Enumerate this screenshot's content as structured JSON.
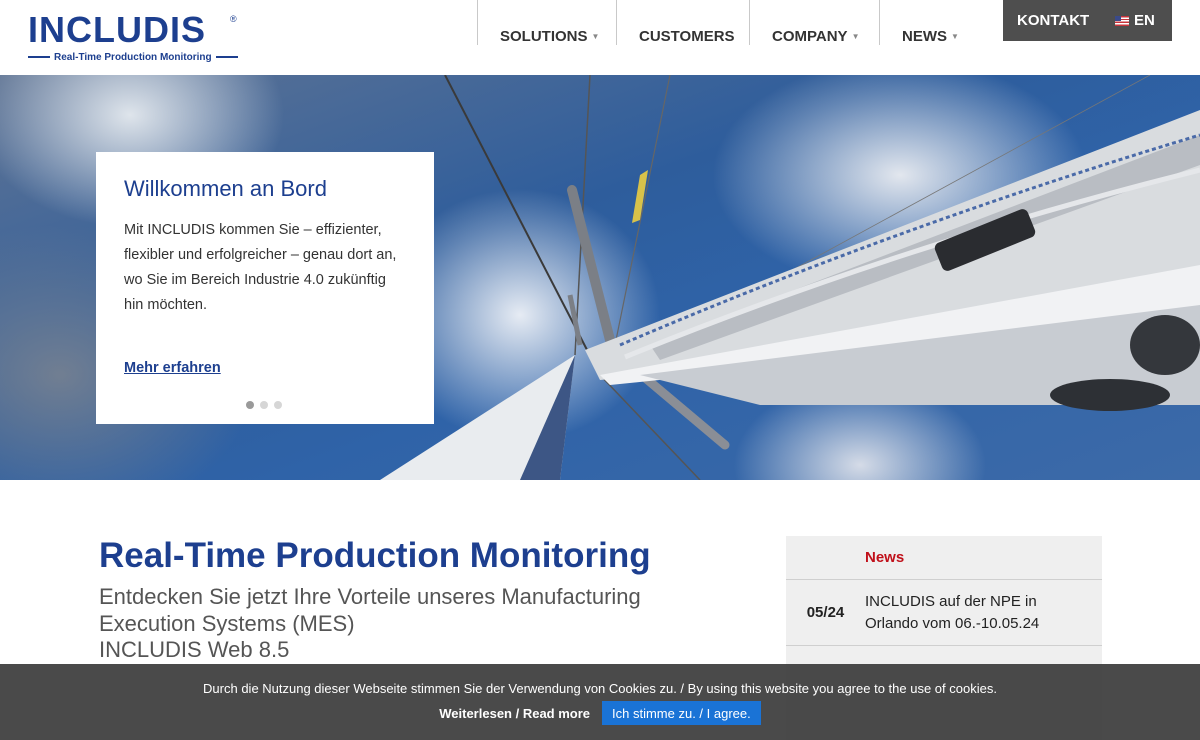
{
  "logo": {
    "name": "INCLUDIS",
    "registered": "®",
    "tagline": "Real-Time Production Monitoring"
  },
  "nav": {
    "items": [
      {
        "label": "SOLUTIONS",
        "has_dropdown": true
      },
      {
        "label": "CUSTOMERS",
        "has_dropdown": false
      },
      {
        "label": "COMPANY",
        "has_dropdown": true
      },
      {
        "label": "NEWS",
        "has_dropdown": true
      }
    ],
    "caret": "▼"
  },
  "topbar": {
    "contact_label": "KONTAKT",
    "language_label": "EN",
    "flag_icon": "us-flag-icon"
  },
  "hero": {
    "title": "Willkommen an Bord",
    "text": "Mit INCLUDIS kommen Sie – effizienter, flexibler und erfolgreicher – genau dort an, wo Sie im Bereich Industrie 4.0 zukünftig hin möchten.",
    "link": "Mehr erfahren",
    "slides": 3,
    "active_slide": 1
  },
  "main": {
    "title": "Real-Time Production Monitoring",
    "subtitle_line1": "Entdecken Sie jetzt Ihre Vorteile unseres Manufacturing Execution Systems (MES)",
    "subtitle_line2": "INCLUDIS Web 8.5"
  },
  "news": {
    "heading": "News",
    "heading_color": "#c0101a",
    "items": [
      {
        "date": "05/24",
        "text": "INCLUDIS auf der NPE in Orlando vom 06.-10.05.24"
      }
    ]
  },
  "cookie": {
    "message": "Durch die Nutzung dieser Webseite stimmen Sie der Verwendung von Cookies zu. / By using this website you agree to the use of cookies.",
    "read_more": "Weiterlesen / Read more",
    "agree": "Ich stimme zu. / I agree."
  },
  "colors": {
    "brand_blue": "#1d3f8f",
    "topbar_bg": "#4e4e4e",
    "button_blue": "#1a73d6"
  }
}
